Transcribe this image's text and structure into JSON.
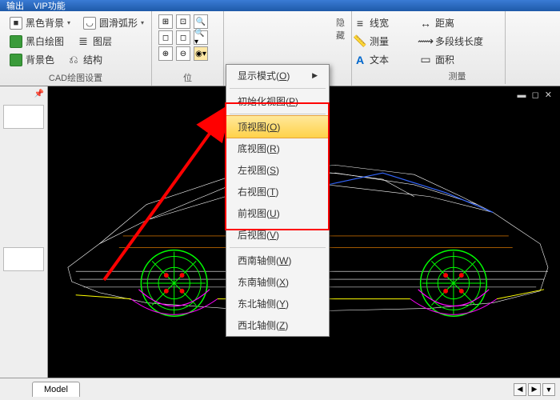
{
  "titlebar": {
    "item1": "输出",
    "item2": "VIP功能"
  },
  "ribbon": {
    "group1": {
      "btn1": "黑色背景",
      "btn2": "圆滑弧形",
      "btn3": "黑白绘图",
      "btn4": "图层",
      "btn5": "背景色",
      "btn6": "结构",
      "label": "CAD绘图设置"
    },
    "group2": {
      "label": "位"
    },
    "group3": {
      "btn1": "线宽",
      "btn2": "测量",
      "btn3": "文本",
      "label": "隐藏"
    },
    "group4": {
      "btn1": "距离",
      "btn2": "多段线长度",
      "btn3": "面积",
      "label": "测量"
    }
  },
  "menu": {
    "item0": {
      "text": "显示模式",
      "key": "O"
    },
    "item1": {
      "text": "初始化视图",
      "key": "P"
    },
    "item2": {
      "text": "顶视图",
      "key": "O"
    },
    "item3": {
      "text": "底视图",
      "key": "R"
    },
    "item4": {
      "text": "左视图",
      "key": "S"
    },
    "item5": {
      "text": "右视图",
      "key": "T"
    },
    "item6": {
      "text": "前视图",
      "key": "U"
    },
    "item7": {
      "text": "后视图",
      "key": "V"
    },
    "item8": {
      "text": "西南轴侧",
      "key": "W"
    },
    "item9": {
      "text": "东南轴侧",
      "key": "X"
    },
    "item10": {
      "text": "东北轴侧",
      "key": "Y"
    },
    "item11": {
      "text": "西北轴侧",
      "key": "Z"
    }
  },
  "status": {
    "tab": "Model"
  },
  "viewport": {
    "controls": "▬ ◻ ✕"
  }
}
